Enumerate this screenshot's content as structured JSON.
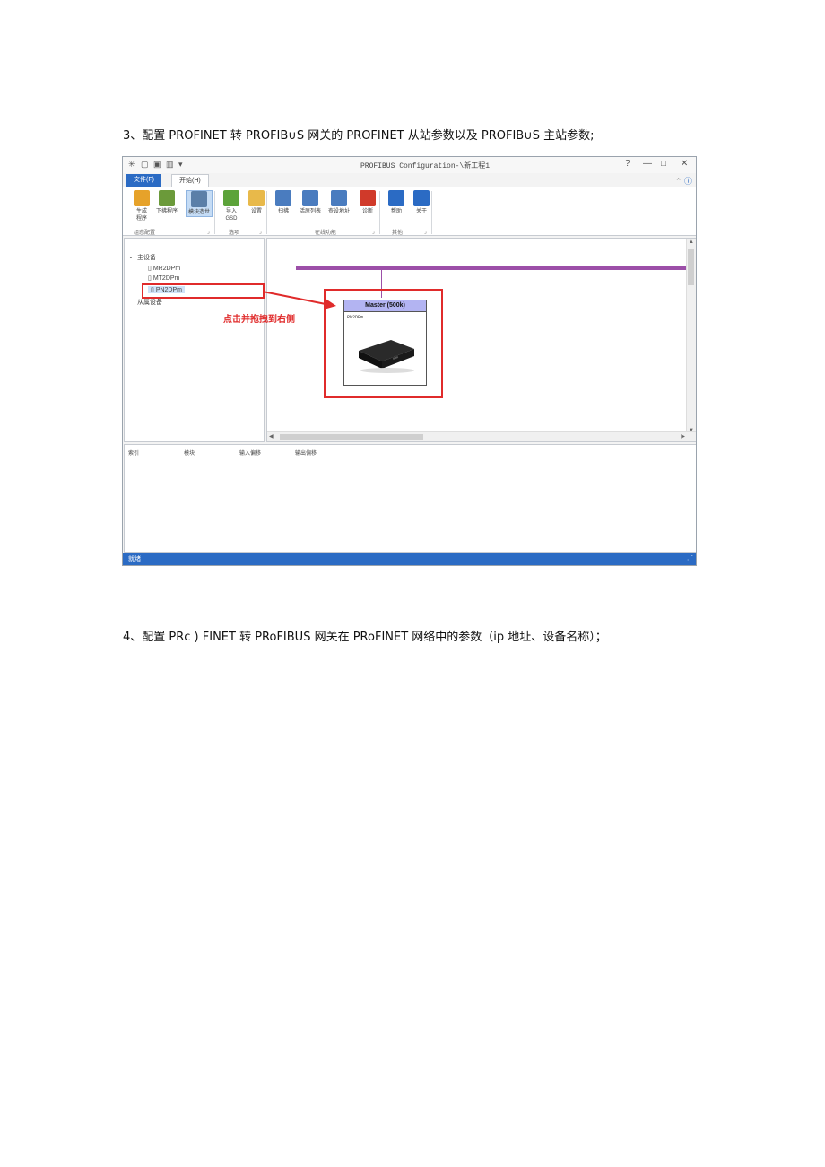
{
  "doc": {
    "step3": "3、配置 PROFINET 转 PROFIB∪S 网关的 PROFINET 从站参数以及 PROFIB∪S 主站参数;",
    "step4": "4、配置 PRc ) FINET 转 PRoFIBUS 网关在 PRoFINET 网络中的参数（ip 地址、设备名称）；"
  },
  "window": {
    "title": "PROFIBUS Configuration-\\新工程1",
    "quick_access": [
      "✳",
      "▢",
      "▣",
      "▥",
      "▾"
    ],
    "controls": [
      "?",
      "—",
      "□",
      "✕"
    ],
    "tabs": [
      {
        "label": "文件(F)"
      },
      {
        "label": "开始(H)"
      }
    ]
  },
  "ribbon": {
    "buttons": [
      {
        "label": "生成\n程序",
        "icon": "bricks-icon",
        "color": "#e6a22a"
      },
      {
        "label": "下拂程序",
        "icon": "download-icon",
        "color": "#6b9a3a"
      },
      {
        "label": "模块造世",
        "icon": "module-icon",
        "color": "#5b7fa8",
        "selected": true
      },
      {
        "label": "导入\nGSD",
        "icon": "import-icon",
        "color": "#5ca33a"
      },
      {
        "label": "设置",
        "icon": "settings-icon",
        "color": "#e8b94a"
      },
      {
        "label": "扫拂",
        "icon": "scan-icon",
        "color": "#4a7cbf"
      },
      {
        "label": "活原列表",
        "icon": "list-icon",
        "color": "#4a7cbf"
      },
      {
        "label": "查设地址",
        "icon": "address-icon",
        "color": "#4a7cbf"
      },
      {
        "label": "诊断",
        "icon": "diagnose-icon",
        "color": "#d03a2a"
      },
      {
        "label": "帮助",
        "icon": "help-icon",
        "color": "#2b6bc4"
      },
      {
        "label": "关于",
        "icon": "info-icon",
        "color": "#2b6bc4"
      }
    ],
    "groups": [
      {
        "label": "组态配置"
      },
      {
        "label": "选项"
      },
      {
        "label": "在线功能"
      },
      {
        "label": "其他"
      }
    ]
  },
  "tree": {
    "master_root": "主设备",
    "items": [
      "MR2DPm",
      "MT2DPm",
      "PN2DPm"
    ],
    "slave_root": "从属设备"
  },
  "canvas": {
    "master_box_title": "Master (500k)",
    "master_box_sub": "PN2DPm",
    "annotation": "点击并拖拽到右侧"
  },
  "table": {
    "columns": [
      "索引",
      "模块",
      "输入偏移",
      "输出偏移"
    ]
  },
  "status": {
    "text": "就绪"
  },
  "colors": {
    "accent": "#2b6bc4",
    "bus": "#9c4fa8",
    "highlight": "#e02b2b",
    "master_header": "#b3b4f2"
  }
}
